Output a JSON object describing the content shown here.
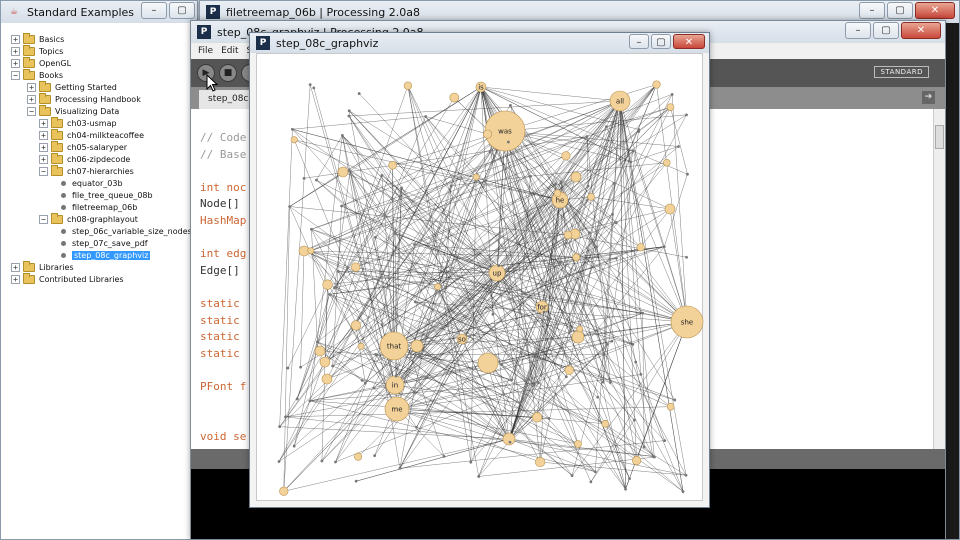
{
  "tree_window": {
    "title": "Standard Examples",
    "items": [
      {
        "label": "Basics",
        "expander": "+",
        "type": "folder",
        "depth": 0
      },
      {
        "label": "Topics",
        "expander": "+",
        "type": "folder",
        "depth": 0
      },
      {
        "label": "OpenGL",
        "expander": "+",
        "type": "folder",
        "depth": 0
      },
      {
        "label": "Books",
        "expander": "−",
        "type": "folder",
        "depth": 0
      },
      {
        "label": "Getting Started",
        "expander": "+",
        "type": "folder",
        "depth": 1
      },
      {
        "label": "Processing Handbook",
        "expander": "+",
        "type": "folder",
        "depth": 1
      },
      {
        "label": "Visualizing Data",
        "expander": "−",
        "type": "folder",
        "depth": 1
      },
      {
        "label": "ch03-usmap",
        "expander": "+",
        "type": "folder",
        "depth": 2
      },
      {
        "label": "ch04-milkteacoffee",
        "expander": "+",
        "type": "folder",
        "depth": 2
      },
      {
        "label": "ch05-salaryper",
        "expander": "+",
        "type": "folder",
        "depth": 2
      },
      {
        "label": "ch06-zipdecode",
        "expander": "+",
        "type": "folder",
        "depth": 2
      },
      {
        "label": "ch07-hierarchies",
        "expander": "−",
        "type": "folder",
        "depth": 2
      },
      {
        "label": "equator_03b",
        "type": "file",
        "depth": 3
      },
      {
        "label": "file_tree_queue_08b",
        "type": "file",
        "depth": 3
      },
      {
        "label": "filetreemap_06b",
        "type": "file",
        "depth": 3
      },
      {
        "label": "ch08-graphlayout",
        "expander": "−",
        "type": "folder",
        "depth": 2
      },
      {
        "label": "step_06c_variable_size_nodes",
        "type": "file",
        "depth": 3
      },
      {
        "label": "step_07c_save_pdf",
        "type": "file",
        "depth": 3
      },
      {
        "label": "step_08c_graphviz",
        "type": "file",
        "depth": 3,
        "selected": true
      },
      {
        "label": "Libraries",
        "expander": "+",
        "type": "folder",
        "depth": 0
      },
      {
        "label": "Contributed Libraries",
        "expander": "+",
        "type": "folder",
        "depth": 0
      }
    ]
  },
  "pde_window": {
    "title": "filetreemap_06b | Processing 2.0a8"
  },
  "editor_window": {
    "title": "step_08c_graphviz | Processing 2.0a8",
    "menu": [
      "File",
      "Edit",
      "Sk"
    ],
    "mode_label": "STANDARD",
    "tab_label": "step_08c",
    "code_lines": [
      {
        "text": "// Code",
        "cls": "cm"
      },
      {
        "text": "// Base",
        "cls": "cm"
      },
      {
        "text": "",
        "cls": ""
      },
      {
        "text": "int noc",
        "cls": "kw"
      },
      {
        "text": "Node[]",
        "cls": "ty"
      },
      {
        "text": "HashMap",
        "cls": "kw"
      },
      {
        "text": "",
        "cls": ""
      },
      {
        "text": "int edg",
        "cls": "kw"
      },
      {
        "text": "Edge[]",
        "cls": "ty"
      },
      {
        "text": "",
        "cls": ""
      },
      {
        "text": "static",
        "cls": "kw"
      },
      {
        "text": "static",
        "cls": "kw"
      },
      {
        "text": "static",
        "cls": "kw"
      },
      {
        "text": "static",
        "cls": "kw"
      },
      {
        "text": "",
        "cls": ""
      },
      {
        "text": "PFont f",
        "cls": "kw"
      },
      {
        "text": "",
        "cls": ""
      },
      {
        "text": "",
        "cls": ""
      },
      {
        "text": "void se",
        "cls": "kw"
      }
    ]
  },
  "sketch_window": {
    "title": "step_08c_graphviz",
    "node_color": "#f3d29a",
    "node_stroke": "#b9924f",
    "edge_color": "#2a2a2a",
    "labeled_nodes": [
      {
        "label": "is"
      },
      {
        "label": "was"
      },
      {
        "label": "all"
      },
      {
        "label": "he"
      },
      {
        "label": "up"
      },
      {
        "label": "for"
      },
      {
        "label": "she"
      },
      {
        "label": "that"
      },
      {
        "label": "so"
      },
      {
        "label": "in"
      },
      {
        "label": "me"
      }
    ]
  },
  "colors": {
    "selection": "#3399ff",
    "keyword": "#cc6633",
    "comment": "#999999"
  }
}
